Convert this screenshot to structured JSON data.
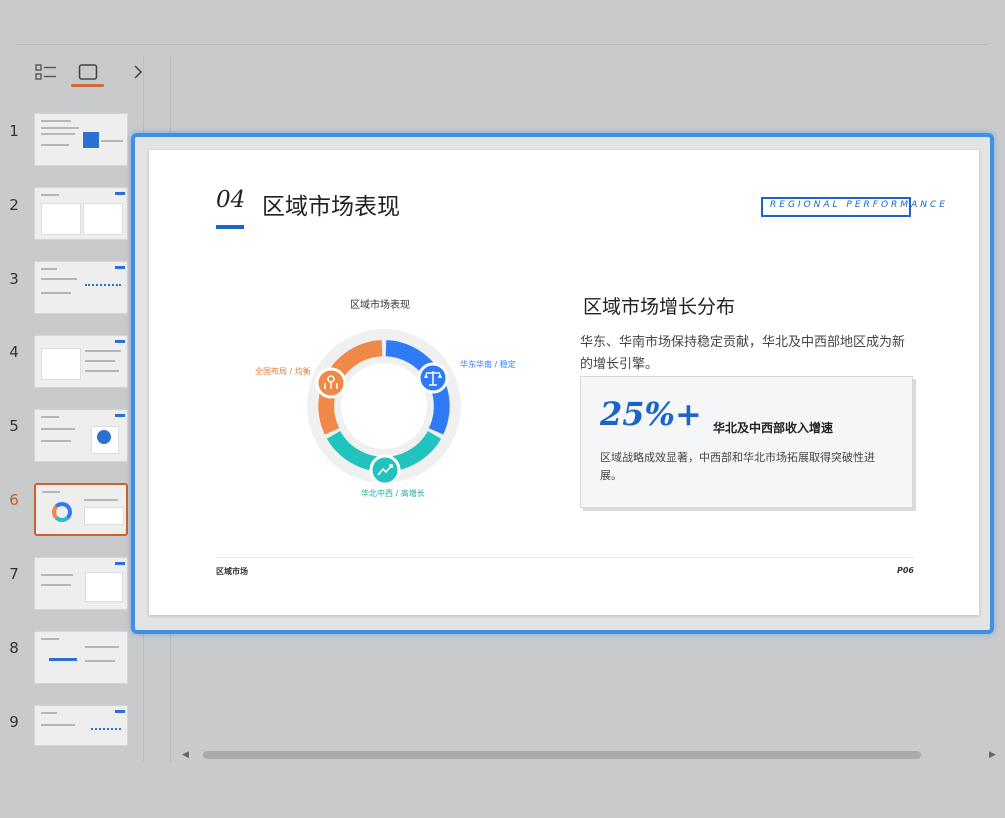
{
  "sidebar": {
    "slide_numbers": [
      "1",
      "2",
      "3",
      "4",
      "5",
      "6",
      "7",
      "8",
      "9"
    ],
    "active_index": "6"
  },
  "slide": {
    "title_num": "04",
    "title_text": "区域市场表现",
    "tag": "REGIONAL PERFORMANCE",
    "chart_title": "区域市场表现",
    "segments": [
      {
        "label": "华东华南 / 稳定",
        "color": "#2f7bf5"
      },
      {
        "label": "华北中西 / 高增长",
        "color": "#22c3bf"
      },
      {
        "label": "全国布局 / 均衡",
        "color": "#f08848"
      }
    ],
    "right_title": "区域市场增长分布",
    "right_desc": "华东、华南市场保持稳定贡献，华北及中西部地区成为新的增长引擎。",
    "highlight_value": "25%+",
    "highlight_label": "华北及中西部收入增速",
    "card_desc": "区域战略成效显著，中西部和华北市场拓展取得突破性进展。",
    "footer_left": "区域市场",
    "footer_right": "P06"
  }
}
